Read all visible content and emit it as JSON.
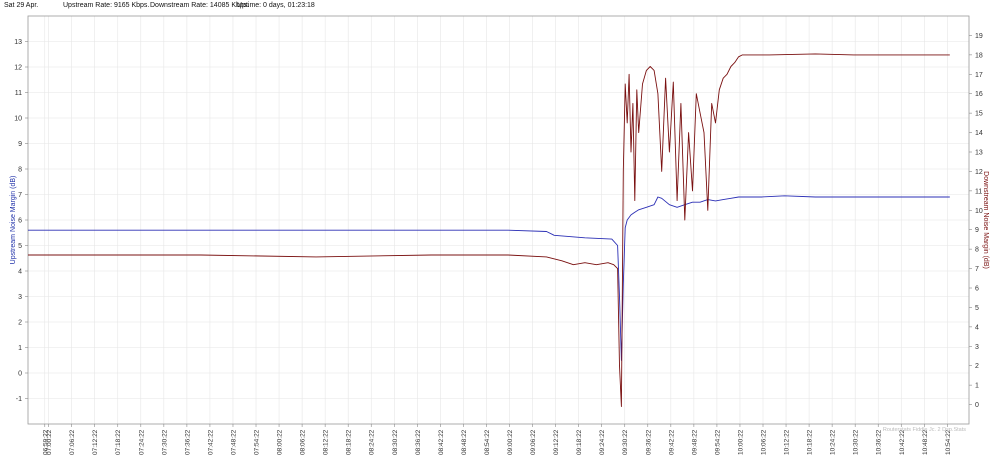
{
  "header": {
    "date": "Sat 29 Apr.",
    "upstream_rate": "Upstream Rate: 9165 Kbps.",
    "downstream_rate": "Downstream Rate: 14085 Kbps.",
    "uptime": "Uptime: 0 days, 01:23:18"
  },
  "colors": {
    "upstream": "#2b2fb5",
    "downstream": "#7a1010",
    "grid": "#e6e6e6",
    "axis": "#999999"
  },
  "chart_data": {
    "type": "line",
    "grid": true,
    "xlabel": "",
    "y_left": {
      "label": "Upstream Noise Margin (dB)",
      "range": [
        -2,
        14
      ],
      "ticks": [
        -1,
        0,
        1,
        2,
        3,
        4,
        5,
        6,
        7,
        8,
        9,
        10,
        11,
        12,
        13
      ]
    },
    "y_right": {
      "label": "Downstream Noise Margin (dB)",
      "range": [
        -1,
        20
      ],
      "ticks": [
        0,
        1,
        2,
        3,
        4,
        5,
        6,
        7,
        8,
        9,
        10,
        11,
        12,
        13,
        14,
        15,
        16,
        17,
        18,
        19
      ]
    },
    "x_range": [
      "06:55:00",
      "11:00:00"
    ],
    "x_tick_labels": [
      "06:59:22",
      "07:00:22",
      "07:06:22",
      "07:12:22",
      "07:18:22",
      "07:24:22",
      "07:30:22",
      "07:36:22",
      "07:42:22",
      "07:48:22",
      "07:54:22",
      "08:00:22",
      "08:06:22",
      "08:12:22",
      "08:18:22",
      "08:24:22",
      "08:30:22",
      "08:36:22",
      "08:42:22",
      "08:48:22",
      "08:54:22",
      "09:00:22",
      "09:06:22",
      "09:12:22",
      "09:18:22",
      "09:24:22",
      "09:30:22",
      "09:36:22",
      "09:42:22",
      "09:48:22",
      "09:54:22",
      "10:00:22",
      "10:06:22",
      "10:12:22",
      "10:18:22",
      "10:24:22",
      "10:30:22",
      "10:36:22",
      "10:42:22",
      "10:48:22",
      "10:54:22"
    ],
    "series": [
      {
        "name": "Upstream Noise Margin (dB)",
        "axis": "left",
        "x": [
          "06:55:00",
          "07:40:00",
          "08:20:00",
          "09:00:00",
          "09:10:00",
          "09:12:00",
          "09:20:00",
          "09:27:00",
          "09:28:30",
          "09:29:00",
          "09:29:30",
          "09:30:00",
          "09:30:30",
          "09:31:00",
          "09:32:00",
          "09:33:00",
          "09:34:00",
          "09:36:00",
          "09:38:00",
          "09:39:00",
          "09:40:00",
          "09:42:00",
          "09:44:00",
          "09:46:00",
          "09:48:00",
          "09:50:00",
          "09:52:00",
          "09:54:00",
          "09:56:00",
          "09:58:00",
          "10:00:00",
          "10:06:00",
          "10:12:00",
          "10:20:00",
          "10:30:00",
          "10:40:00",
          "10:50:00",
          "10:55:00"
        ],
        "y": [
          5.6,
          5.6,
          5.6,
          5.6,
          5.55,
          5.4,
          5.3,
          5.25,
          5.0,
          3.0,
          0.5,
          3.5,
          5.7,
          6.0,
          6.2,
          6.3,
          6.4,
          6.5,
          6.6,
          6.9,
          6.85,
          6.6,
          6.5,
          6.6,
          6.7,
          6.7,
          6.8,
          6.75,
          6.8,
          6.85,
          6.9,
          6.9,
          6.95,
          6.9,
          6.9,
          6.9,
          6.9,
          6.9
        ]
      },
      {
        "name": "Downstream Noise Margin (dB)",
        "axis": "right",
        "x": [
          "06:55:00",
          "07:40:00",
          "08:10:00",
          "08:40:00",
          "09:00:00",
          "09:10:00",
          "09:14:00",
          "09:17:00",
          "09:20:00",
          "09:23:00",
          "09:26:00",
          "09:27:30",
          "09:28:30",
          "09:29:00",
          "09:29:30",
          "09:30:00",
          "09:30:30",
          "09:31:00",
          "09:31:30",
          "09:32:00",
          "09:32:30",
          "09:33:00",
          "09:33:30",
          "09:34:00",
          "09:35:00",
          "09:36:00",
          "09:37:00",
          "09:38:00",
          "09:39:00",
          "09:40:00",
          "09:41:00",
          "09:42:00",
          "09:43:00",
          "09:44:00",
          "09:45:00",
          "09:46:00",
          "09:47:00",
          "09:48:00",
          "09:49:00",
          "09:50:00",
          "09:51:00",
          "09:52:00",
          "09:53:00",
          "09:54:00",
          "09:55:00",
          "09:56:00",
          "09:57:00",
          "09:58:00",
          "09:59:00",
          "10:00:00",
          "10:01:00",
          "10:02:00",
          "10:04:00",
          "10:06:00",
          "10:08:00",
          "10:20:00",
          "10:30:00",
          "10:40:00",
          "10:55:00"
        ],
        "y": [
          7.7,
          7.7,
          7.6,
          7.7,
          7.7,
          7.6,
          7.4,
          7.2,
          7.3,
          7.2,
          7.3,
          7.2,
          7.0,
          2.0,
          -0.1,
          12.0,
          16.5,
          14.5,
          17.0,
          13.0,
          15.5,
          10.5,
          16.2,
          14.0,
          16.5,
          17.2,
          17.4,
          17.2,
          16.0,
          12.0,
          16.8,
          13.0,
          16.6,
          10.5,
          15.5,
          9.5,
          14.0,
          11.0,
          16.0,
          15.0,
          14.0,
          10.0,
          15.5,
          14.5,
          16.2,
          16.8,
          17.0,
          17.4,
          17.6,
          17.9,
          18.0,
          18.0,
          18.0,
          18.0,
          18.0,
          18.05,
          18.0,
          18.0,
          18.0
        ]
      }
    ]
  },
  "watermark": "Routerstats Fiddle Jc. 2 Dsp.Stats"
}
